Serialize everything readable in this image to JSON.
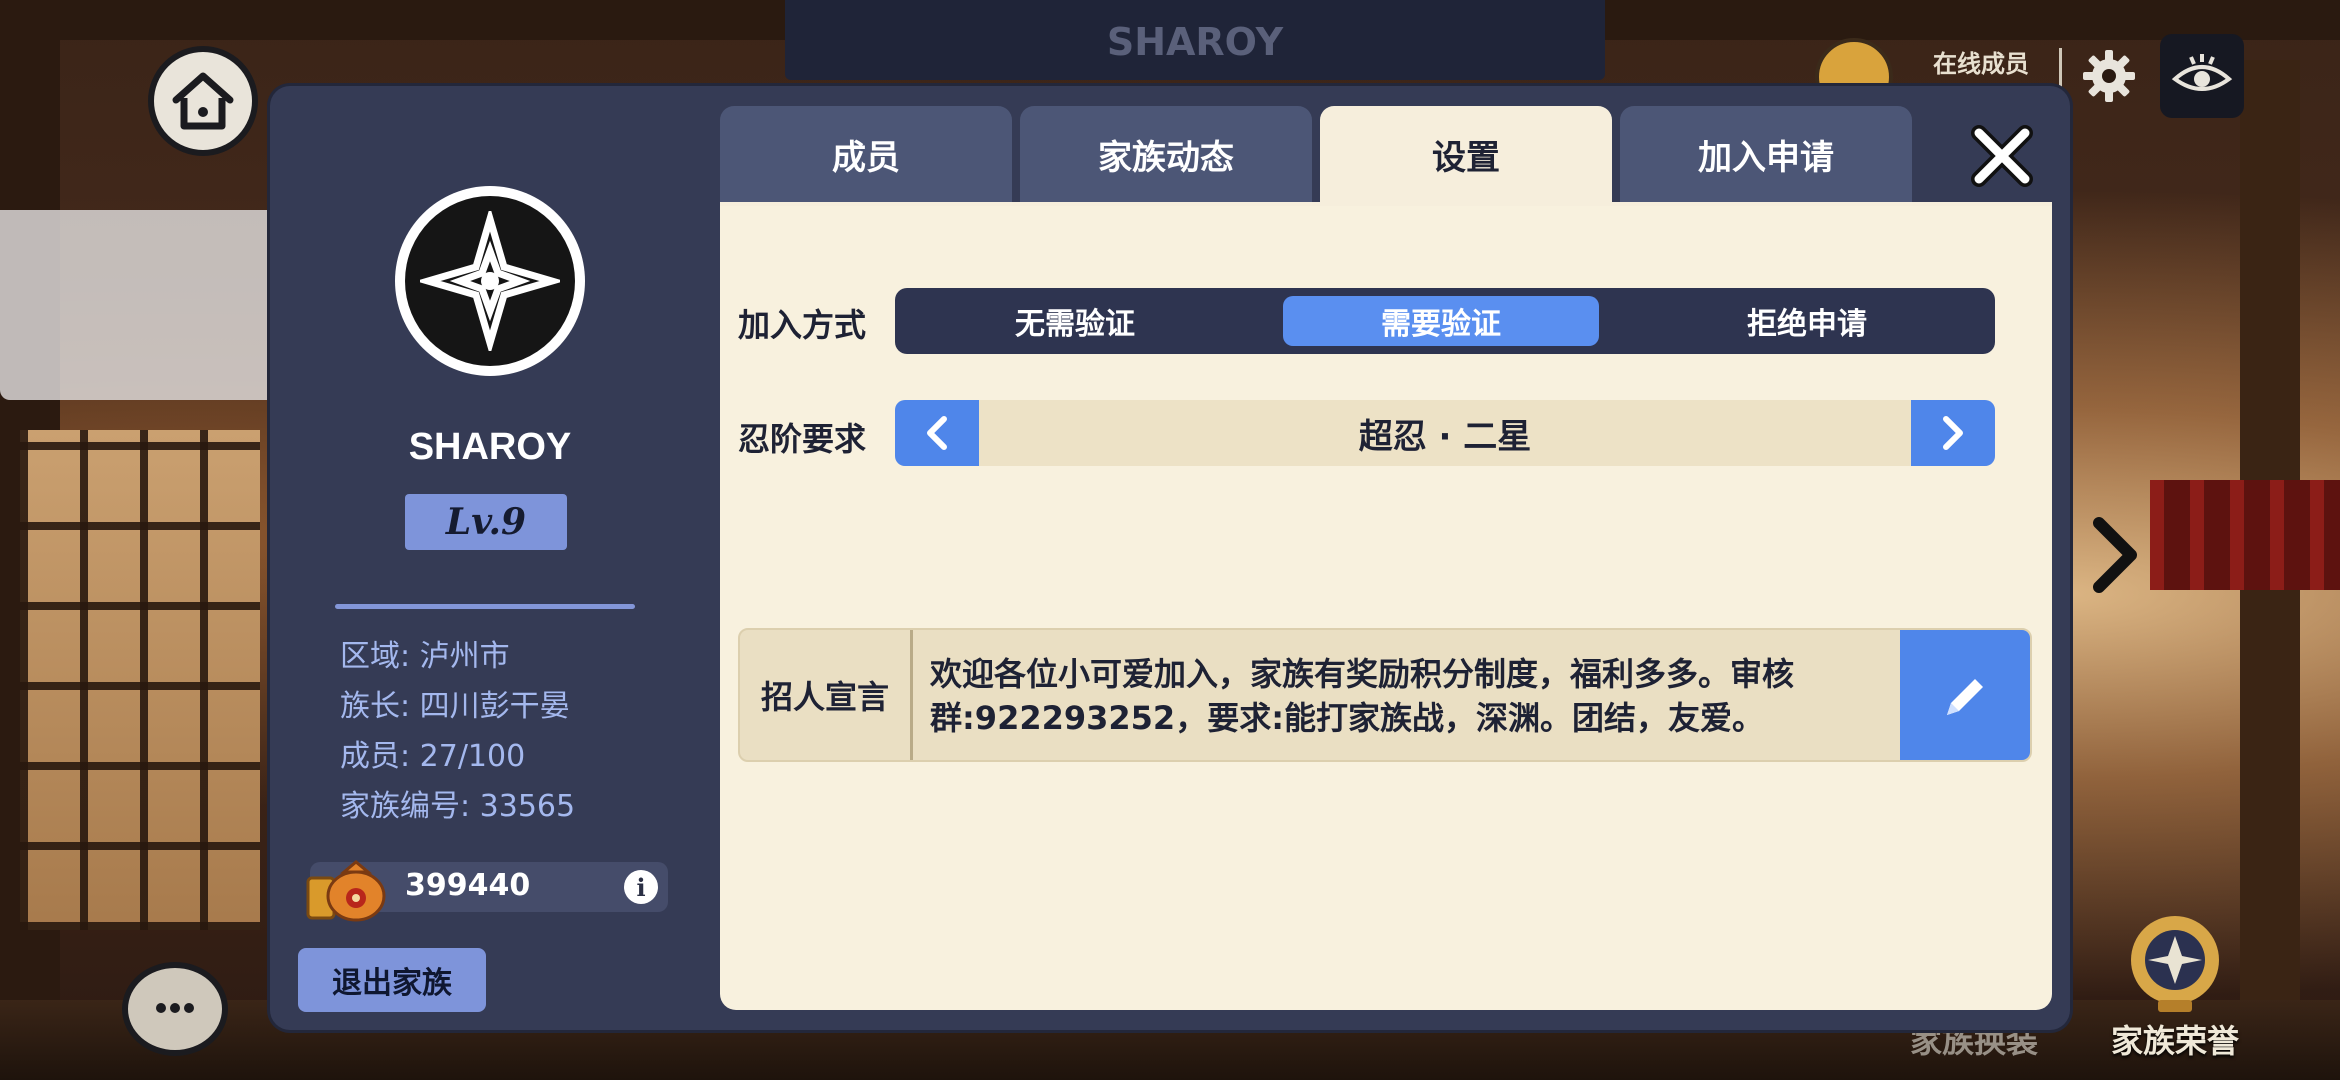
{
  "background": {
    "sign_title": "SHAROY",
    "online_label": "在线成员",
    "family_honor_label": "家族荣誉",
    "family_outfit_label": "家族换装"
  },
  "family": {
    "name": "SHAROY",
    "level": "Lv.9",
    "region": "区域: 泸州市",
    "leader": "族长: 四川彭干晏",
    "members": "成员: 27/100",
    "family_id": "家族编号: 33565",
    "funds": "399440",
    "quit_label": "退出家族"
  },
  "tabs": [
    {
      "label": "成员",
      "active": false
    },
    {
      "label": "家族动态",
      "active": false
    },
    {
      "label": "设置",
      "active": true
    },
    {
      "label": "加入申请",
      "active": false
    }
  ],
  "settings": {
    "join_label": "加入方式",
    "join_options": [
      "无需验证",
      "需要验证",
      "拒绝申请"
    ],
    "join_selected": "需要验证",
    "rank_label": "忍阶要求",
    "rank_value": "超忍 · 二星",
    "recruit_label": "招人宣言",
    "recruit_text": "欢迎各位小可爱加入，家族有奖励积分制度，福利多多。审核群:922293252，要求:能打家族战，深渊。团结，友爱。"
  },
  "colors": {
    "panel_bg": "#353b55",
    "content_bg": "#f8f1de",
    "accent_blue": "#5a8ff0",
    "level_badge": "#7e94da",
    "info_text": "#a4b8ee"
  },
  "icons": [
    "home-icon",
    "chat-icon",
    "gear-icon",
    "eye-icon",
    "close-icon",
    "chevron-left-icon",
    "chevron-right-icon",
    "pencil-icon",
    "coin-bag-icon",
    "info-icon",
    "family-emblem-icon",
    "trophy-icon"
  ]
}
